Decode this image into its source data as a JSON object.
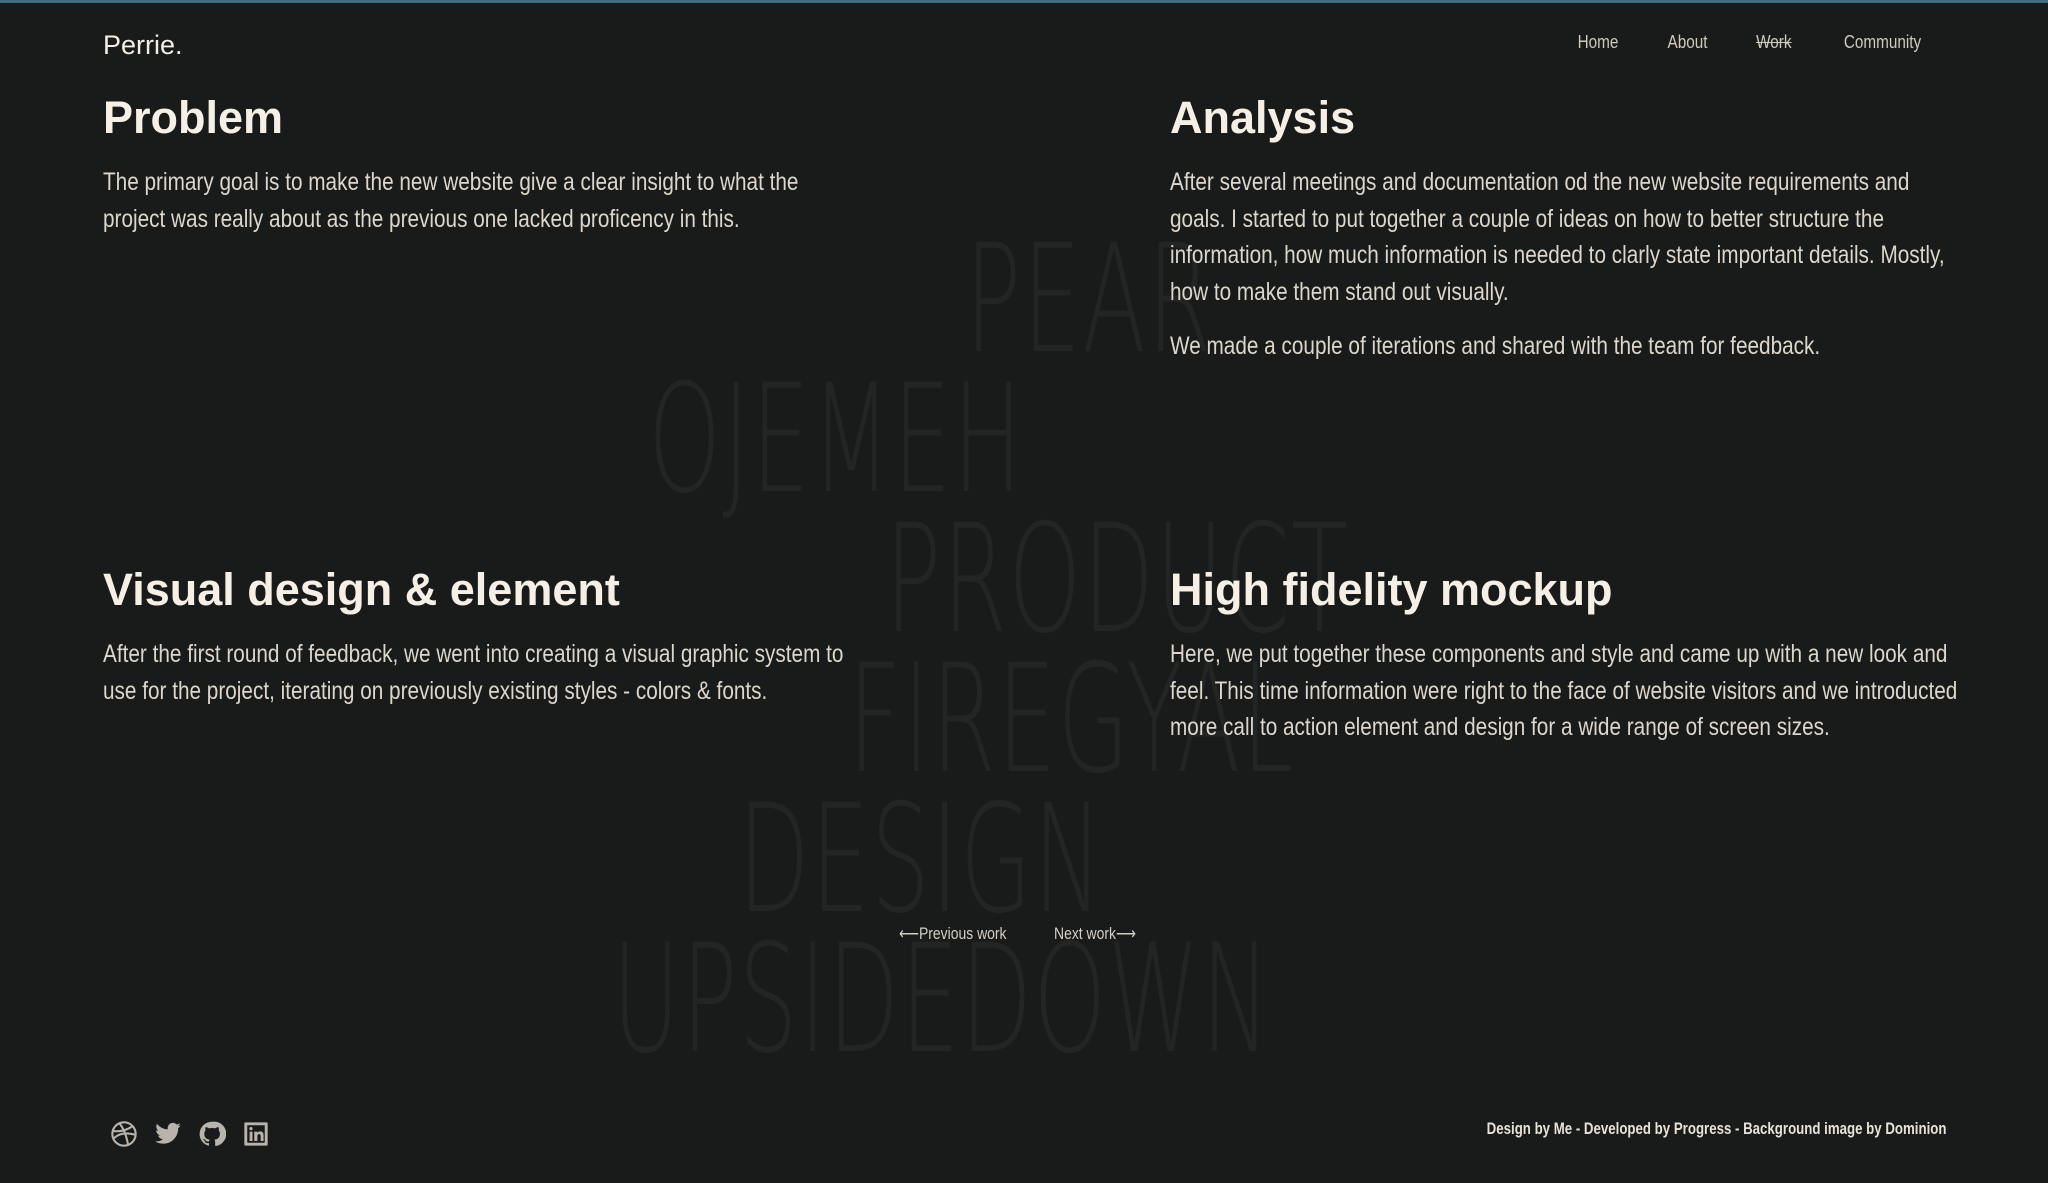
{
  "brand": {
    "name": "Perrie",
    "dot": "."
  },
  "nav": {
    "items": [
      {
        "label": "Home"
      },
      {
        "label": "About"
      },
      {
        "label": "Work",
        "active": true
      },
      {
        "label": "Community"
      }
    ]
  },
  "background_words": [
    "PEAR",
    "OJEMEH",
    "PRODUCT",
    "FIREGYAL",
    "DESIGN",
    "UPSIDEDOWN"
  ],
  "sections": {
    "problem": {
      "title": "Problem",
      "body": "The primary goal is to make the new website give a clear insight to what the project was really about as the previous one lacked proficency in this."
    },
    "analysis": {
      "title": "Analysis",
      "body": "After several meetings and documentation od the new website requirements and goals. I started to put together a couple of ideas on how to better structure the information, how much information is needed to clarly state important details. Mostly, how to make them stand out visually.",
      "body2": "We made a couple of iterations and shared with the team for feedback."
    },
    "visual": {
      "title": "Visual design & element",
      "body": "After the first round of feedback, we went into creating a visual graphic system to use for the project, iterating on previously existing styles - colors & fonts."
    },
    "mockup": {
      "title": "High fidelity mockup",
      "body": "Here, we put together these components and style and came up with a new look and feel. This time information were right to the face of website visitors and we introducted more call to action element and design for a wide range of screen sizes."
    }
  },
  "pager": {
    "prev": "⟵Previous work",
    "next": "Next work⟶"
  },
  "footer": {
    "social_icons": [
      "dribbble-icon",
      "twitter-icon",
      "github-icon",
      "linkedin-icon"
    ],
    "credits": "Design by Me - Developed by Progress - Background image by Dominion"
  },
  "colors": {
    "background": "#191a1a",
    "text": "#efe9df",
    "accent_line": "#3a6f80"
  }
}
